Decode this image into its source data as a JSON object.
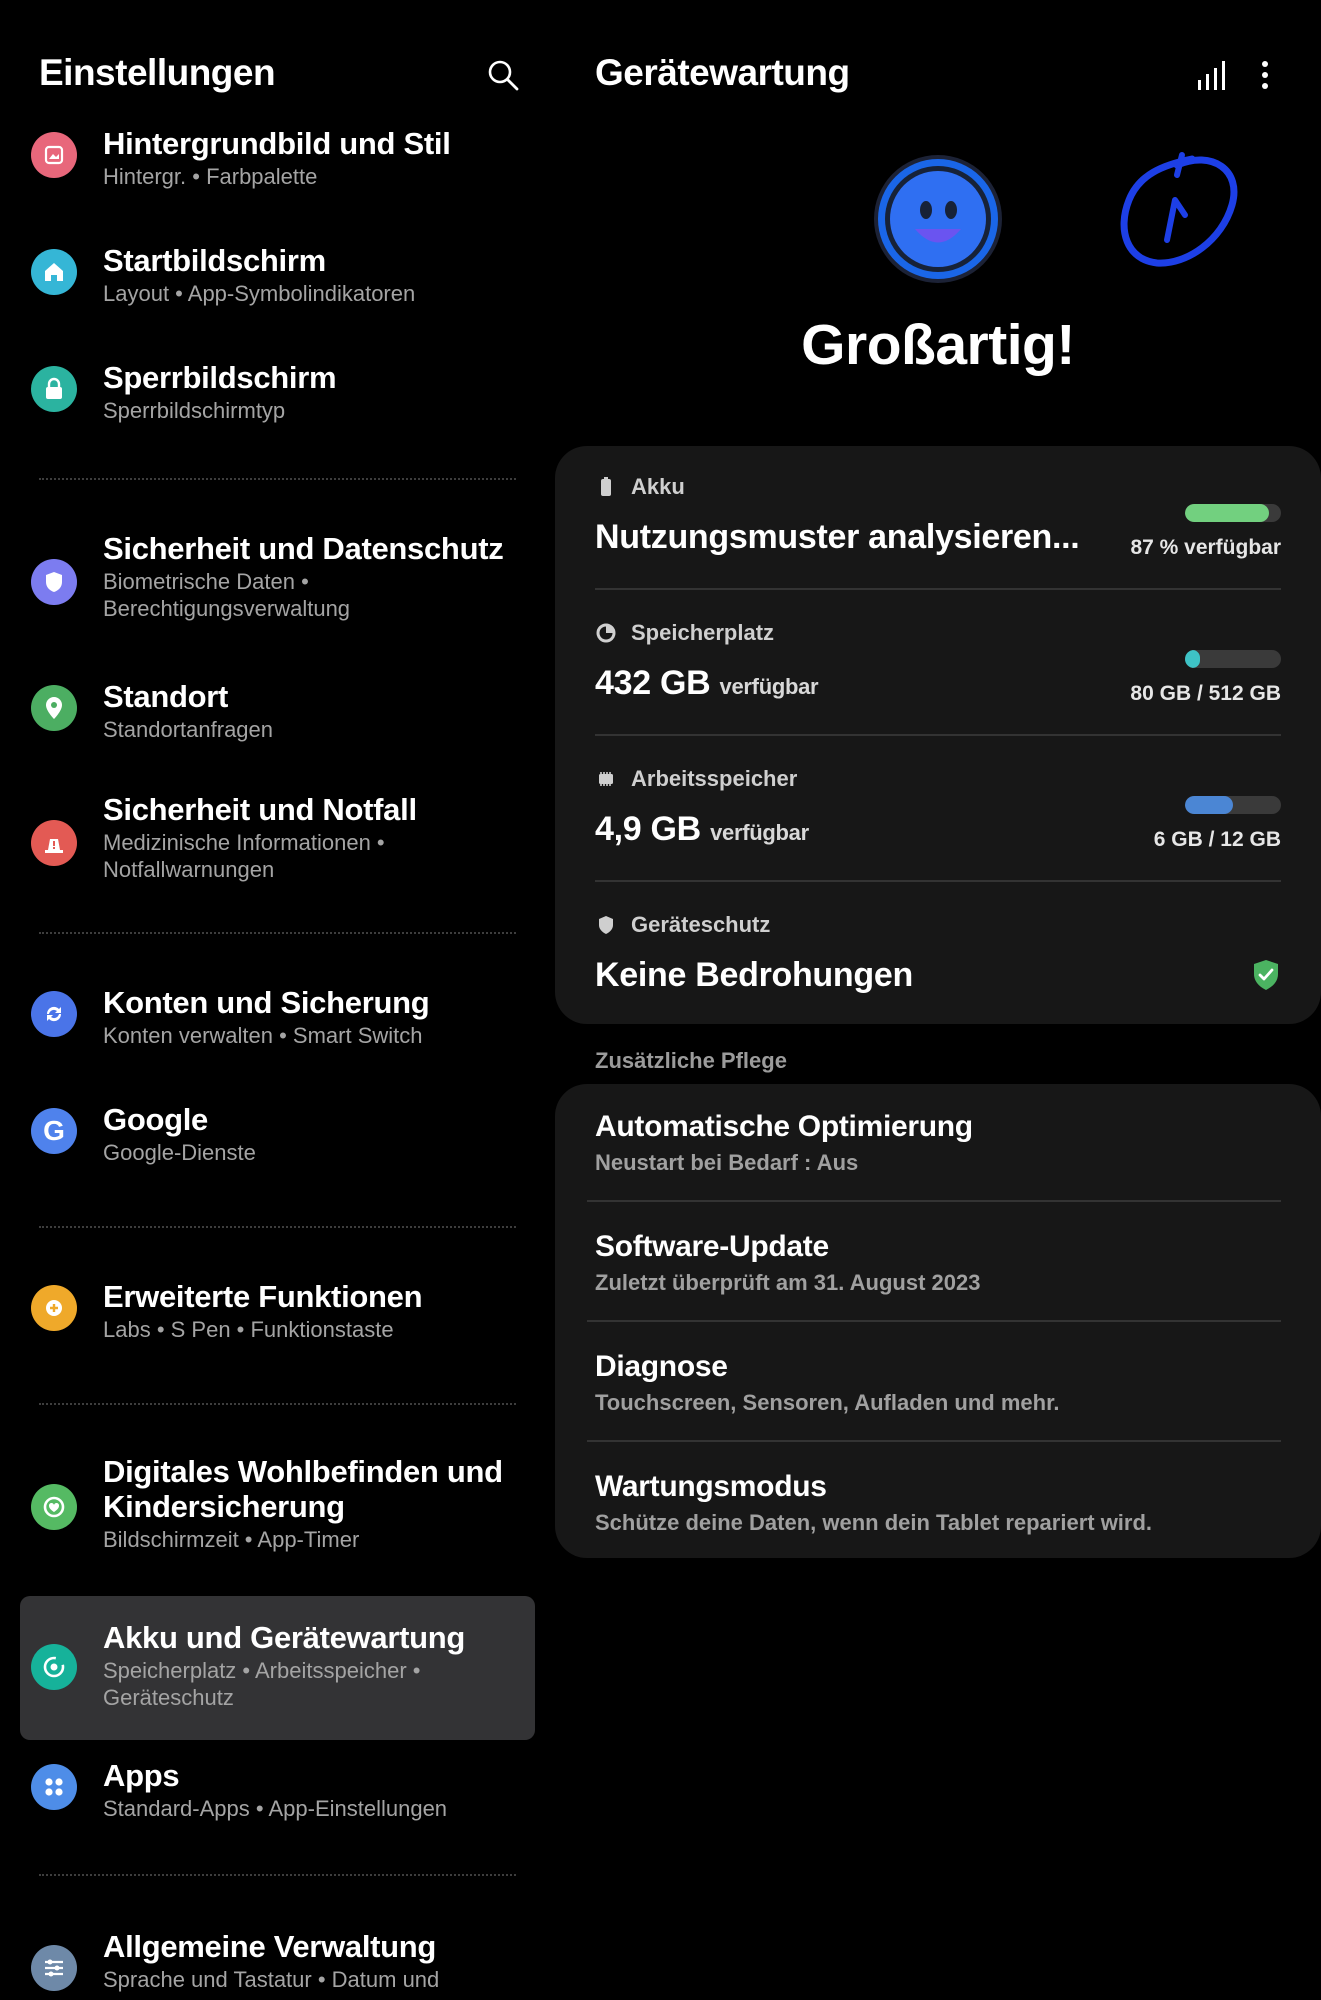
{
  "left": {
    "title": "Einstellungen",
    "search_icon": "search-icon",
    "items": [
      {
        "title": "Hintergrundbild und Stil",
        "subtitle": "Hintergr.  •  Farbpalette",
        "icon": "wallpaper-icon",
        "color": "#e8677b"
      },
      {
        "title": "Startbildschirm",
        "subtitle": "Layout  •  App-Symbolindikatoren",
        "icon": "home-icon",
        "color": "#35b6d6"
      },
      {
        "title": "Sperrbildschirm",
        "subtitle": "Sperrbildschirmtyp",
        "icon": "lock-icon",
        "color": "#2bb3a0"
      },
      {
        "title": "Sicherheit und Datenschutz",
        "subtitle": "Biometrische Daten  •\nBerechtigungsverwaltung",
        "icon": "shield-icon",
        "color": "#7c7cf0"
      },
      {
        "title": "Standort",
        "subtitle": "Standortanfragen",
        "icon": "location-icon",
        "color": "#4cae62"
      },
      {
        "title": "Sicherheit und Notfall",
        "subtitle": "Medizinische Informationen  •\nNotfallwarnungen",
        "icon": "emergency-icon",
        "color": "#e35a54"
      },
      {
        "title": "Konten und Sicherung",
        "subtitle": "Konten verwalten  •  Smart Switch",
        "icon": "sync-icon",
        "color": "#4a74e8"
      },
      {
        "title": "Google",
        "subtitle": "Google-Dienste",
        "icon": "google-icon",
        "color": "#4f82ec"
      },
      {
        "title": "Erweiterte Funktionen",
        "subtitle": "Labs  •  S Pen  •  Funktionstaste",
        "icon": "gear-plus-icon",
        "color": "#efa92a"
      },
      {
        "title": "Digitales Wohlbefinden und Kindersicherung",
        "subtitle": "Bildschirmzeit  •  App-Timer",
        "icon": "wellbeing-icon",
        "color": "#55ba63"
      },
      {
        "title": "Akku und Gerätewartung",
        "subtitle": "Speicherplatz  •  Arbeitsspeicher  •\nGeräteschutz",
        "icon": "device-care-icon",
        "color": "#16b29a"
      },
      {
        "title": "Apps",
        "subtitle": "Standard-Apps  •  App-Einstellungen",
        "icon": "apps-icon",
        "color": "#4e8de8"
      },
      {
        "title": "Allgemeine Verwaltung",
        "subtitle": "Sprache und Tastatur  •  Datum und",
        "icon": "sliders-icon",
        "color": "#6e89a8"
      }
    ]
  },
  "right": {
    "title": "Gerätewartung",
    "signal_icon": "signal-bars-icon",
    "more_icon": "more-vertical-icon",
    "status": "Großartig!",
    "battery": {
      "label": "Akku",
      "value": "Nutzungsmuster analysieren...",
      "meta": "87 % verfügbar",
      "fill": 0.87,
      "color": "#72d07f"
    },
    "storage": {
      "label": "Speicherplatz",
      "value": "432 GB",
      "unit": "verfügbar",
      "meta": "80 GB / 512 GB",
      "fill": 0.16,
      "color": "#3ec3c6"
    },
    "memory": {
      "label": "Arbeitsspeicher",
      "value": "4,9 GB",
      "unit": "verfügbar",
      "meta": "6 GB / 12 GB",
      "fill": 0.5,
      "color": "#4b86d4"
    },
    "protection": {
      "label": "Geräteschutz",
      "value": "Keine Bedrohungen"
    },
    "section": "Zusätzliche Pflege",
    "care": [
      {
        "title": "Automatische Optimierung",
        "subtitle": "Neustart bei Bedarf : Aus"
      },
      {
        "title": "Software-Update",
        "subtitle": "Zuletzt überprüft am 31. August 2023"
      },
      {
        "title": "Diagnose",
        "subtitle": "Touchscreen, Sensoren, Aufladen und mehr."
      },
      {
        "title": "Wartungsmodus",
        "subtitle": "Schütze deine Daten, wenn dein Tablet repariert wird."
      }
    ]
  }
}
